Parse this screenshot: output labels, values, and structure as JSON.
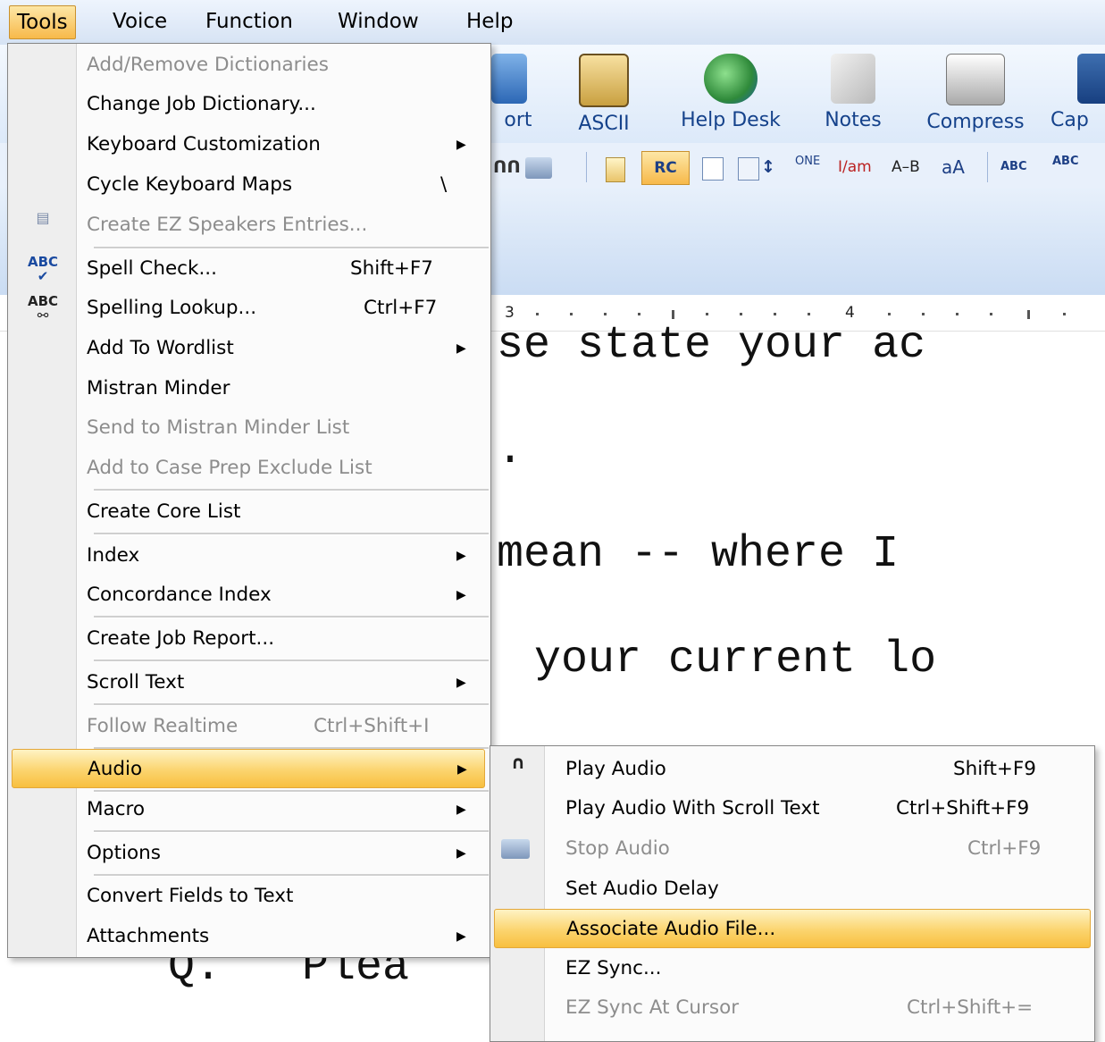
{
  "menubar": {
    "items": [
      {
        "label": "Tools",
        "active": true
      },
      {
        "label": "Voice"
      },
      {
        "label": "Function"
      },
      {
        "label": "Window"
      },
      {
        "label": "Help"
      }
    ]
  },
  "ribbon": {
    "buttons": [
      {
        "label": "ort",
        "icon": "export-icon"
      },
      {
        "label": "ASCII",
        "icon": "ascii-file-icon"
      },
      {
        "label": "Help Desk",
        "icon": "globe-computer-icon"
      },
      {
        "label": "Notes",
        "icon": "scissors-notes-icon"
      },
      {
        "label": "Compress",
        "icon": "printer-icon"
      },
      {
        "label": "Cap",
        "icon": "caption-icon"
      }
    ],
    "toolbar_glyphs": {
      "rc": "RC",
      "one": "ONE",
      "am": "I/am",
      "ab": "A–B",
      "aa": "aA",
      "abc1": "ABC",
      "abc2": "ABC"
    }
  },
  "ruler": {
    "marks": [
      "3",
      "4"
    ]
  },
  "document": {
    "lines": [
      "se state your ac",
      ".",
      "mean -- where I",
      "your current lo",
      "Q.   Plea"
    ]
  },
  "tools_menu": {
    "items": [
      {
        "label": "Add/Remove Dictionaries",
        "disabled": true
      },
      {
        "label": "Change Job Dictionary..."
      },
      {
        "label": "Keyboard Customization",
        "submenu": true
      },
      {
        "label": "Cycle Keyboard Maps",
        "shortcut": "\\"
      },
      {
        "label": "Create EZ Speakers Entries...",
        "disabled": true,
        "icon": "ez-speakers-icon"
      },
      {
        "label": "Spell Check...",
        "shortcut": "Shift+F7",
        "icon": "spell-check-icon"
      },
      {
        "label": "Spelling Lookup...",
        "shortcut": "Ctrl+F7",
        "icon": "spelling-lookup-icon"
      },
      {
        "label": "Add To Wordlist",
        "submenu": true
      },
      {
        "label": "Mistran Minder"
      },
      {
        "label": "Send to Mistran Minder List",
        "disabled": true
      },
      {
        "label": "Add to Case Prep Exclude List",
        "disabled": true
      },
      {
        "label": "Create Core List"
      },
      {
        "label": "Index",
        "submenu": true
      },
      {
        "label": "Concordance Index",
        "submenu": true
      },
      {
        "label": "Create Job Report..."
      },
      {
        "label": "Scroll Text",
        "submenu": true
      },
      {
        "label": "Follow Realtime",
        "shortcut": "Ctrl+Shift+I",
        "disabled": true
      },
      {
        "label": "Audio",
        "submenu": true,
        "highlighted": true
      },
      {
        "label": "Macro",
        "submenu": true
      },
      {
        "label": "Options",
        "submenu": true
      },
      {
        "label": "Convert Fields to Text"
      },
      {
        "label": "Attachments",
        "submenu": true
      }
    ],
    "icon_text": {
      "spell": "ABC",
      "lookup": "ABC"
    }
  },
  "audio_submenu": {
    "items": [
      {
        "label": "Play Audio",
        "shortcut": "Shift+F9",
        "icon": "headphones-icon"
      },
      {
        "label": "Play Audio With Scroll Text",
        "shortcut": "Ctrl+Shift+F9"
      },
      {
        "label": "Stop Audio",
        "shortcut": "Ctrl+F9",
        "disabled": true,
        "icon": "stop-audio-icon"
      },
      {
        "label": "Set Audio Delay"
      },
      {
        "label": "Associate Audio File...",
        "highlighted": true
      },
      {
        "label": "EZ Sync..."
      },
      {
        "label": "EZ Sync At Cursor",
        "shortcut": "Ctrl+Shift+=",
        "disabled": true
      }
    ]
  },
  "colors": {
    "highlight": "#fbd46e",
    "menu_background": "#fbfbfb",
    "gutter": "#eeeeee",
    "disabled_text": "#8d8d8d",
    "ribbon_text": "#15428b"
  }
}
